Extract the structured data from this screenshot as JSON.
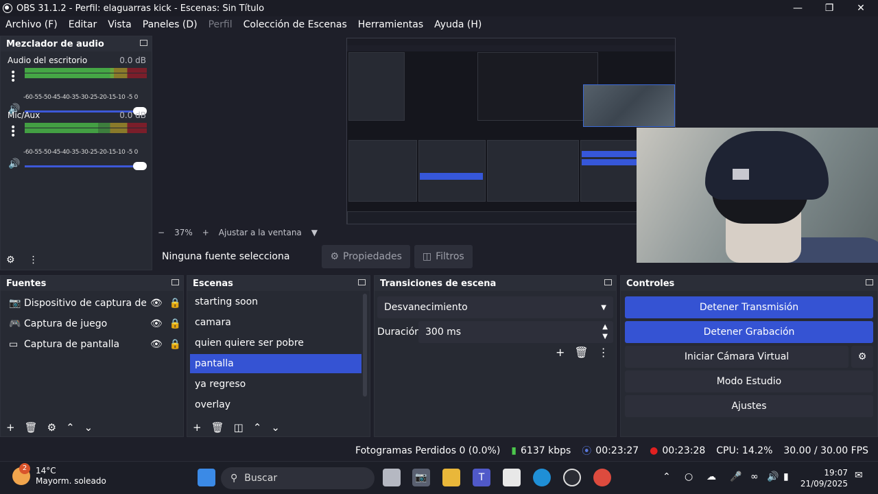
{
  "window": {
    "title": "OBS 31.1.2 - Perfil: elaguarras kick - Escenas: Sin Título"
  },
  "menu": [
    "Archivo (F)",
    "Editar",
    "Vista",
    "Paneles (D)",
    "Perfil",
    "Colección de Escenas",
    "Herramientas",
    "Ayuda (H)"
  ],
  "mixer": {
    "title": "Mezclador de audio",
    "ticks": "-60-55-50-45-40-35-30-25-20-15-10 -5  0",
    "channels": [
      {
        "name": "Audio del escritorio",
        "db": "0.0 dB",
        "level": 0.73,
        "volume": 1.0
      },
      {
        "name": "Mic/Aux",
        "db": "0.0 dB",
        "level": 0.6,
        "volume": 1.0
      }
    ]
  },
  "preview": {
    "zoom": "37%",
    "fit_label": "Ajustar a la ventana"
  },
  "source_toolbar": {
    "no_source": "Ninguna fuente selecciona",
    "properties": "Propiedades",
    "filters": "Filtros"
  },
  "sources": {
    "title": "Fuentes",
    "items": [
      {
        "label": "Dispositivo de captura de vid",
        "icon": "camera-icon"
      },
      {
        "label": "Captura de juego",
        "icon": "gamepad-icon"
      },
      {
        "label": "Captura de pantalla",
        "icon": "monitor-icon"
      }
    ]
  },
  "scenes": {
    "title": "Escenas",
    "items": [
      "starting soon",
      "camara",
      "quien quiere ser pobre",
      "pantalla",
      "ya regreso",
      "overlay"
    ],
    "selected": "pantalla"
  },
  "transitions": {
    "title": "Transiciones de escena",
    "type": "Desvanecimiento",
    "duration_label": "Duración",
    "duration_value": "300 ms"
  },
  "controls": {
    "title": "Controles",
    "stop_stream": "Detener Transmisión",
    "stop_record": "Detener Grabación",
    "virtual_cam": "Iniciar Cámara Virtual",
    "studio_mode": "Modo Estudio",
    "settings": "Ajustes"
  },
  "status": {
    "dropped": "Fotogramas Perdidos 0 (0.0%)",
    "bitrate": "6137 kbps",
    "stream_time": "00:23:27",
    "record_time": "00:23:28",
    "cpu": "CPU: 14.2%",
    "fps": "30.00 / 30.00 FPS"
  },
  "taskbar": {
    "weather_temp": "14°C",
    "weather_desc": "Mayorm. soleado",
    "weather_badge": "2",
    "search": "Buscar",
    "time": "19:07",
    "date": "21/09/2025"
  },
  "colors": {
    "accent": "#3553d3",
    "panel": "#272a33",
    "background": "#1e1f29"
  }
}
